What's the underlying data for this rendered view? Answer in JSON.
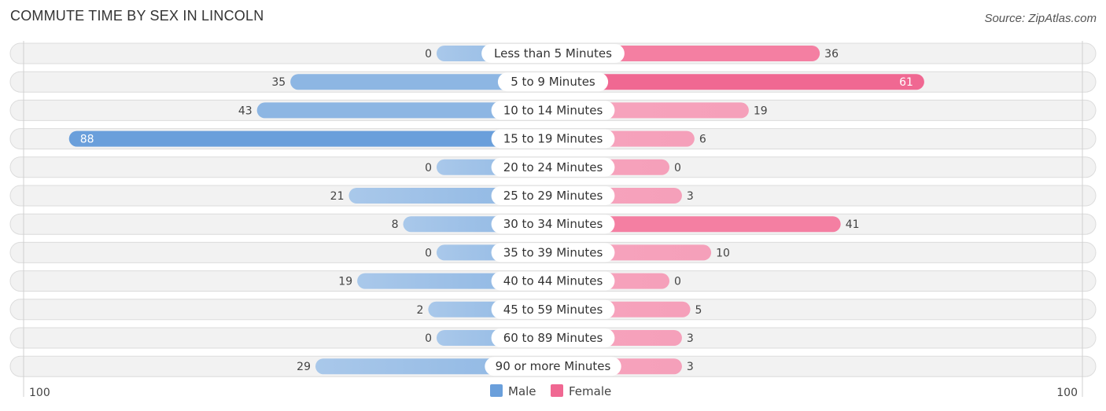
{
  "title": "COMMUTE TIME BY SEX IN LINCOLN",
  "source": "Source: ZipAtlas.com",
  "chart_data": {
    "type": "bar",
    "orientation": "horizontal-diverging",
    "title": "COMMUTE TIME BY SEX IN LINCOLN",
    "categories": [
      "Less than 5 Minutes",
      "5 to 9 Minutes",
      "10 to 14 Minutes",
      "15 to 19 Minutes",
      "20 to 24 Minutes",
      "25 to 29 Minutes",
      "30 to 34 Minutes",
      "35 to 39 Minutes",
      "40 to 44 Minutes",
      "45 to 59 Minutes",
      "60 to 89 Minutes",
      "90 or more Minutes"
    ],
    "series": [
      {
        "name": "Male",
        "color": "#6a9fdb",
        "values": [
          0,
          35,
          43,
          88,
          0,
          21,
          8,
          0,
          19,
          2,
          0,
          29
        ]
      },
      {
        "name": "Female",
        "color": "#f06892",
        "values": [
          36,
          61,
          19,
          6,
          0,
          3,
          41,
          10,
          0,
          5,
          3,
          3
        ]
      }
    ],
    "axis": {
      "left_label": "100",
      "right_label": "100",
      "range": [
        0,
        100
      ]
    },
    "legend": {
      "position": "bottom-center",
      "items": [
        "Male",
        "Female"
      ]
    }
  }
}
